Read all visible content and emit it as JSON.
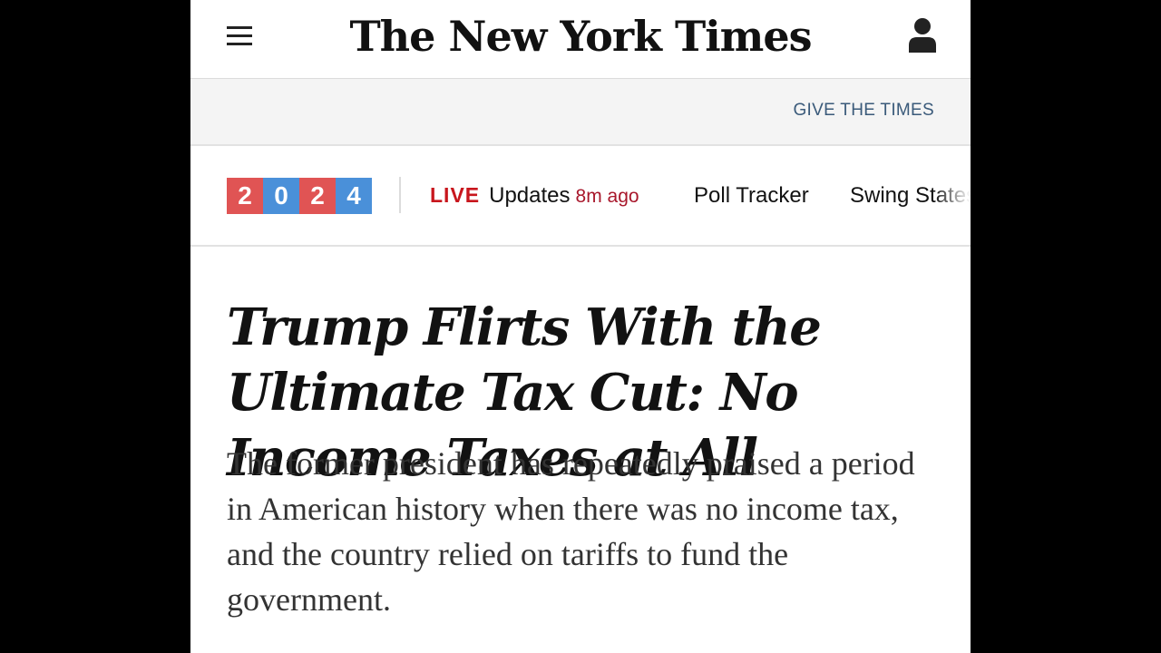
{
  "header": {
    "masthead": "The New York Times",
    "menu_icon": "hamburger-menu-icon",
    "account_icon": "user-account-icon"
  },
  "gift_band": {
    "link": "GIVE THE TIMES"
  },
  "election_nav": {
    "year_digits": [
      "2",
      "0",
      "2",
      "4"
    ],
    "year_colors": [
      "#e05454",
      "#4a90d9",
      "#e05454",
      "#4a90d9"
    ],
    "live_label": "LIVE",
    "updates_label": "Updates",
    "updates_time": "8m ago",
    "poll_tracker": "Poll Tracker",
    "swing_states": "Swing States"
  },
  "article": {
    "headline": "Trump Flirts With the Ultimate Tax Cut: No Income Taxes at All",
    "summary": "The former president has repeatedly praised a period in American history when there was no income tax, and the country relied on tariffs to fund the government."
  },
  "colors": {
    "live_red": "#c8161d",
    "link_blue": "#3a5a7a",
    "band_gray": "#f4f4f4"
  }
}
